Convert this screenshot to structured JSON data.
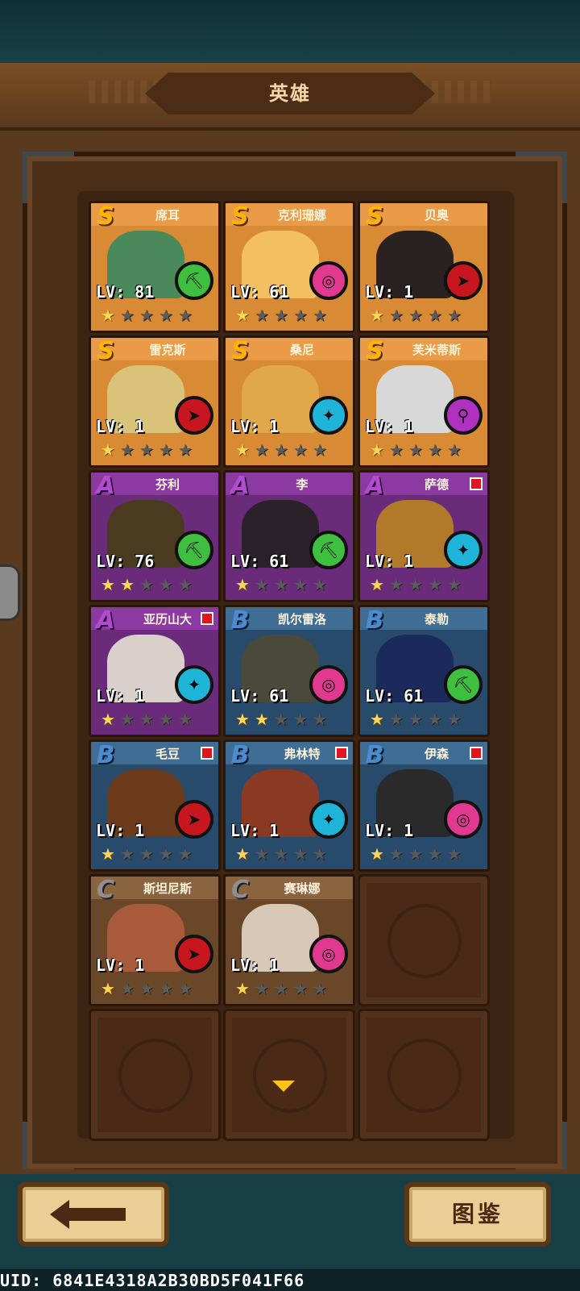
{
  "header": {
    "title": "英雄"
  },
  "heroes": [
    {
      "name": "席耳",
      "tier": "S",
      "level": "LV: 81",
      "stars": 1,
      "element": "green",
      "alert": false,
      "art": "#4a8a5a"
    },
    {
      "name": "克利珊娜",
      "tier": "S",
      "level": "LV: 61",
      "stars": 1,
      "element": "pink",
      "alert": false,
      "art": "#f2c060"
    },
    {
      "name": "贝奥",
      "tier": "S",
      "level": "LV: 1",
      "stars": 1,
      "element": "red",
      "alert": false,
      "art": "#2a2220"
    },
    {
      "name": "雷克斯",
      "tier": "S",
      "level": "LV: 1",
      "stars": 1,
      "element": "red",
      "alert": false,
      "art": "#d9c27a"
    },
    {
      "name": "桑尼",
      "tier": "S",
      "level": "LV: 1",
      "stars": 1,
      "element": "cyan",
      "alert": false,
      "art": "#e0a84a"
    },
    {
      "name": "芙米蒂斯",
      "tier": "S",
      "level": "LV: 1",
      "stars": 1,
      "element": "magenta",
      "alert": false,
      "art": "#d8d8d8"
    },
    {
      "name": "芬利",
      "tier": "A",
      "level": "LV: 76",
      "stars": 2,
      "element": "green",
      "alert": false,
      "art": "#4a3a20"
    },
    {
      "name": "李",
      "tier": "A",
      "level": "LV: 61",
      "stars": 1,
      "element": "green",
      "alert": false,
      "art": "#2a2228"
    },
    {
      "name": "萨德",
      "tier": "A",
      "level": "LV: 1",
      "stars": 1,
      "element": "cyan",
      "alert": true,
      "art": "#b07a2a"
    },
    {
      "name": "亚历山大",
      "tier": "A",
      "level": "LV: 1",
      "stars": 1,
      "element": "cyan",
      "alert": true,
      "art": "#d9d0cc"
    },
    {
      "name": "凯尔雷洛",
      "tier": "B",
      "level": "LV: 61",
      "stars": 2,
      "element": "pink",
      "alert": false,
      "art": "#4a4a3a"
    },
    {
      "name": "泰勒",
      "tier": "B",
      "level": "LV: 61",
      "stars": 1,
      "element": "green",
      "alert": false,
      "art": "#1a2a5a"
    },
    {
      "name": "毛豆",
      "tier": "B",
      "level": "LV: 1",
      "stars": 1,
      "element": "red",
      "alert": true,
      "art": "#6a3a1a"
    },
    {
      "name": "弗林特",
      "tier": "B",
      "level": "LV: 1",
      "stars": 1,
      "element": "cyan",
      "alert": true,
      "art": "#8a3a22"
    },
    {
      "name": "伊森",
      "tier": "B",
      "level": "LV: 1",
      "stars": 1,
      "element": "pink",
      "alert": true,
      "art": "#2a2a2a"
    },
    {
      "name": "斯坦尼斯",
      "tier": "C",
      "level": "LV: 1",
      "stars": 1,
      "element": "red",
      "alert": false,
      "art": "#a85a3a"
    },
    {
      "name": "赛琳娜",
      "tier": "C",
      "level": "LV: 1",
      "stars": 1,
      "element": "pink",
      "alert": false,
      "art": "#d8c8b8"
    }
  ],
  "element_colors": {
    "green": "#3fbf3f",
    "pink": "#e0398f",
    "red": "#c8161e",
    "cyan": "#1eb5d8",
    "magenta": "#b030c0"
  },
  "element_icons": {
    "green": "⛏",
    "pink": "◎",
    "red": "➤",
    "cyan": "✦",
    "magenta": "⚲"
  },
  "footer": {
    "back_label": "",
    "dex_label": "图鉴"
  },
  "uid": "UID: 6841E4318A2B30BD5F041F66"
}
